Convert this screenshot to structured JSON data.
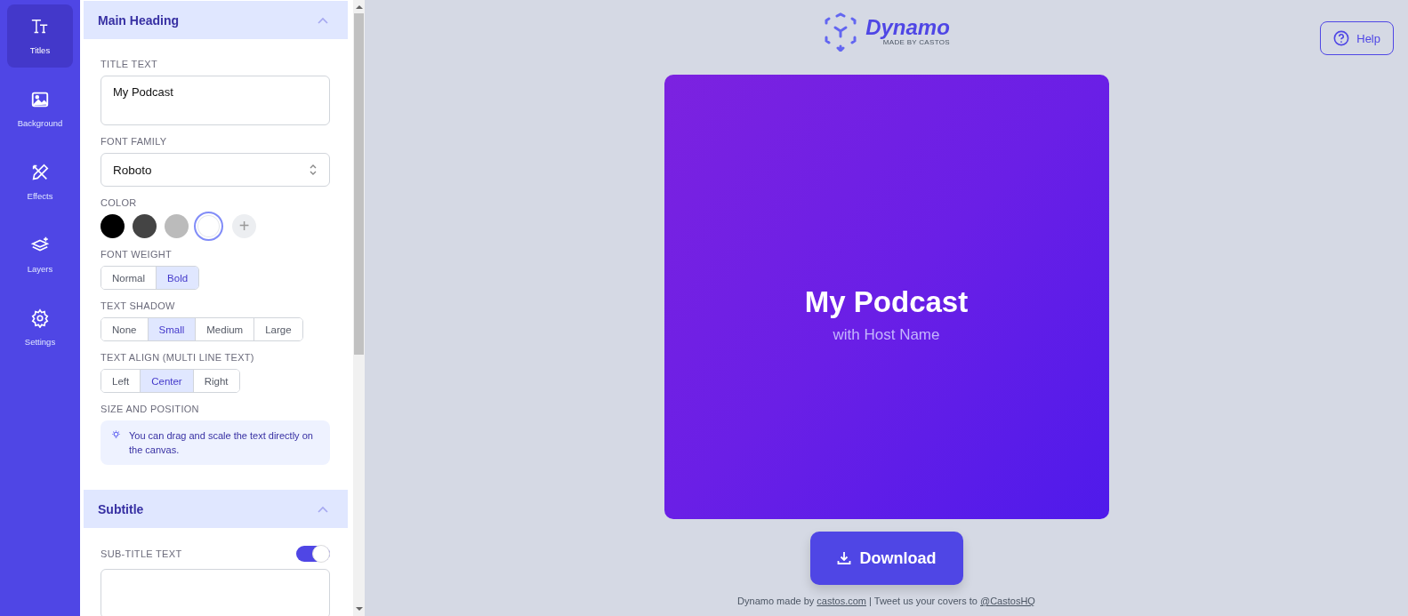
{
  "nav": [
    {
      "label": "Titles",
      "selected": true
    },
    {
      "label": "Background",
      "selected": false
    },
    {
      "label": "Effects",
      "selected": false
    },
    {
      "label": "Layers",
      "selected": false
    },
    {
      "label": "Settings",
      "selected": false
    }
  ],
  "main_heading": {
    "title": "Main Heading",
    "expanded": true,
    "title_text": {
      "label": "TITLE TEXT",
      "value": "My Podcast"
    },
    "font_family": {
      "label": "FONT FAMILY",
      "value": "Roboto"
    },
    "color": {
      "label": "COLOR",
      "swatches": [
        {
          "color": "#000000",
          "selected": false
        },
        {
          "color": "#444444",
          "selected": false
        },
        {
          "color": "#bbbbbb",
          "selected": false
        },
        {
          "color": "#ffffff",
          "selected": true
        }
      ],
      "add": "+"
    },
    "font_weight": {
      "label": "FONT WEIGHT",
      "options": [
        {
          "label": "Normal",
          "selected": false
        },
        {
          "label": "Bold",
          "selected": true
        }
      ]
    },
    "text_shadow": {
      "label": "TEXT SHADOW",
      "options": [
        {
          "label": "None",
          "selected": false
        },
        {
          "label": "Small",
          "selected": true
        },
        {
          "label": "Medium",
          "selected": false
        },
        {
          "label": "Large",
          "selected": false
        }
      ]
    },
    "text_align": {
      "label": "TEXT ALIGN (MULTI LINE TEXT)",
      "options": [
        {
          "label": "Left",
          "selected": false
        },
        {
          "label": "Center",
          "selected": true
        },
        {
          "label": "Right",
          "selected": false
        }
      ]
    },
    "size_position": {
      "label": "SIZE AND POSITION",
      "hint": "You can drag and scale the text directly on the canvas."
    }
  },
  "subtitle": {
    "title": "Subtitle",
    "expanded": true,
    "subtitle_text": {
      "label": "SUB-TITLE TEXT",
      "on": true
    }
  },
  "logo": {
    "name": "Dynamo",
    "tagline": "MADE BY CASTOS"
  },
  "help": "Help",
  "cover": {
    "title": "My Podcast",
    "subtitle": "with Host Name"
  },
  "download": "Download",
  "footer": {
    "prefix": "Dynamo made by ",
    "link1": "castos.com",
    "middle": " | Tweet us your covers to ",
    "link2": "@CastosHQ"
  }
}
